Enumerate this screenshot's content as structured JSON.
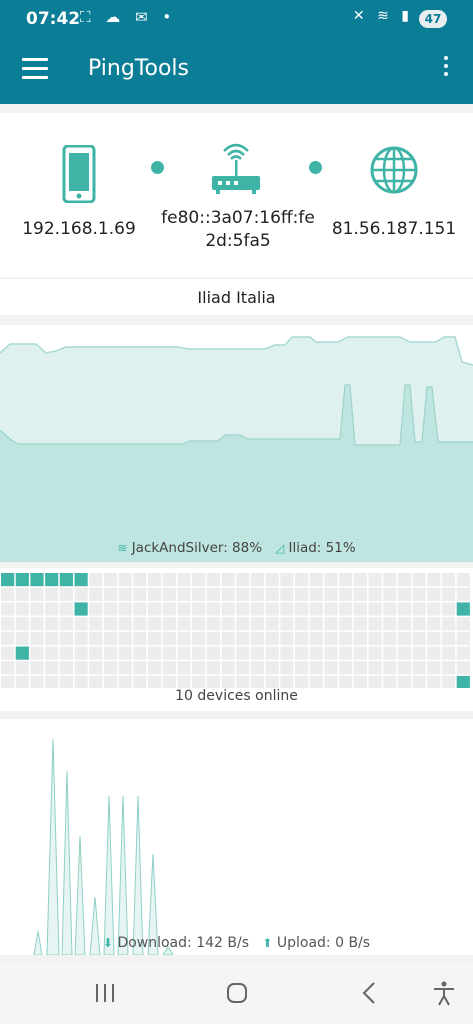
{
  "status_bar": {
    "time": "07:42",
    "battery": "47"
  },
  "app_bar": {
    "title": "PingTools"
  },
  "network": {
    "local_ip": "192.168.1.69",
    "router_ipv6_line1": "fe80::3a07:16ff:fe",
    "router_ipv6_line2": "2d:5fa5",
    "external_ip": "81.56.187.151",
    "isp": "Iliad Italia"
  },
  "signal_chart": {
    "wifi_label": "JackAndSilver: 88%",
    "cell_label": "Iliad: 51%",
    "accent_color": "#3eb3a6"
  },
  "lan_grid": {
    "devices_label": "10 devices online"
  },
  "traffic": {
    "download_label": "Download: 142 B/s",
    "upload_label": "Upload: 0 B/s"
  },
  "colors": {
    "primary": "#0b7d96",
    "accent": "#3eb3a6"
  }
}
